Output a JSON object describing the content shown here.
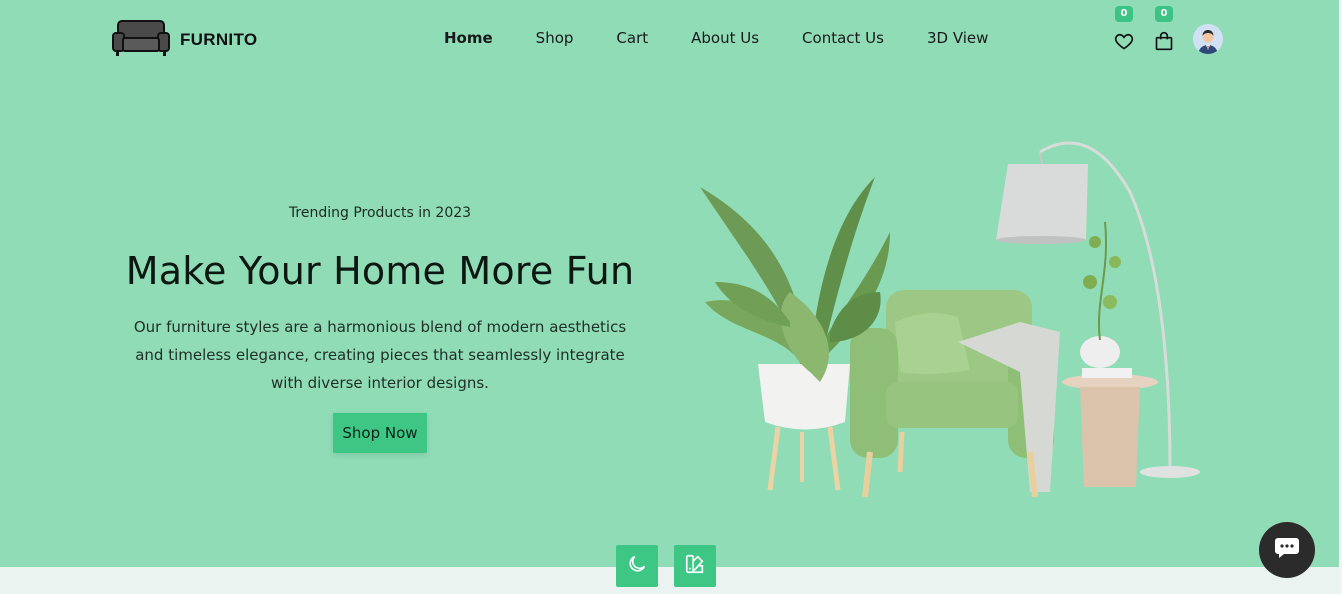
{
  "brand": {
    "name": "FURNITO",
    "logo_icon": "sofa-icon"
  },
  "nav": {
    "items": [
      {
        "label": "Home",
        "active": true
      },
      {
        "label": "Shop",
        "active": false
      },
      {
        "label": "Cart",
        "active": false
      },
      {
        "label": "About Us",
        "active": false
      },
      {
        "label": "Contact Us",
        "active": false
      },
      {
        "label": "3D View",
        "active": false
      }
    ]
  },
  "header_icons": {
    "wishlist": {
      "icon": "heart-icon",
      "count": "0"
    },
    "cart": {
      "icon": "shopping-bag-icon",
      "count": "0"
    },
    "profile": {
      "icon": "user-avatar"
    }
  },
  "hero": {
    "eyebrow": "Trending Products in 2023",
    "headline": "Make Your Home More Fun",
    "description": "Our furniture styles are a harmonious blend of modern aesthetics and timeless elegance, creating pieces that seamlessly integrate with diverse interior designs.",
    "cta_label": "Shop Now",
    "image_icon": "armchair-plant-lamp-illustration"
  },
  "floating_actions": {
    "dark_mode": {
      "icon": "moon-icon"
    },
    "theme": {
      "icon": "palette-icon"
    },
    "chat": {
      "icon": "chat-bubble-icon"
    }
  },
  "colors": {
    "background": "#8fdcb6",
    "accent": "#3ec685",
    "chat_button": "#2b2b2b",
    "bottom_strip": "#eaf3ef"
  }
}
